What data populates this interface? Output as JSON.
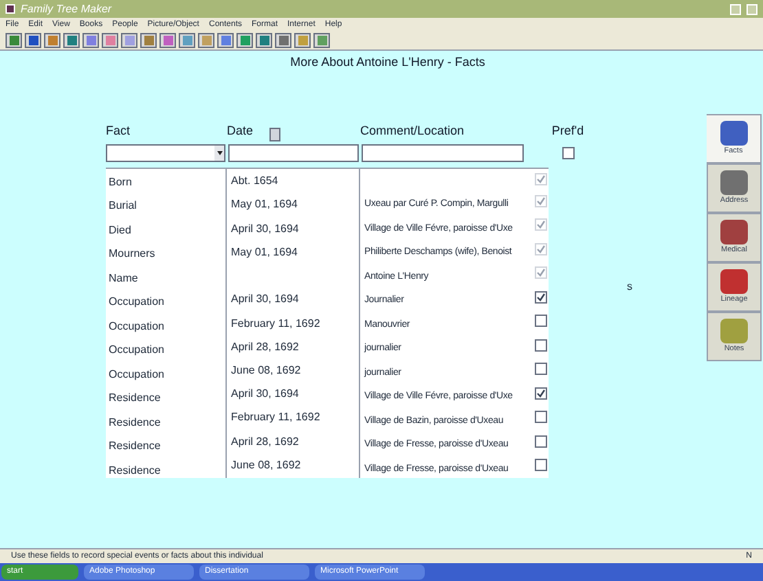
{
  "window": {
    "title": "Family Tree Maker"
  },
  "menu": [
    "File",
    "Edit",
    "View",
    "Books",
    "People",
    "Picture/Object",
    "Contents",
    "Format",
    "Internet",
    "Help"
  ],
  "page_title": "More About Antoine L'Henry - Facts",
  "table": {
    "columns": [
      "Fact",
      "Date",
      "Comment/Location",
      "Pref'd"
    ],
    "new_row": {
      "preferred": false
    },
    "rows": [
      {
        "fact": "Born",
        "date": "Abt. 1654",
        "comment": "",
        "preferred": true,
        "disabled": true
      },
      {
        "fact": "Burial",
        "date": "May 01, 1694",
        "comment": "Uxeau par Curé P. Compin, Margulli",
        "preferred": true,
        "disabled": true
      },
      {
        "fact": "Died",
        "date": "April 30, 1694",
        "comment": "Village de Ville Févre, paroisse d'Uxe",
        "preferred": true,
        "disabled": true
      },
      {
        "fact": "Mourners",
        "date": "May 01, 1694",
        "comment": "Philiberte Deschamps (wife), Benoist",
        "preferred": true,
        "disabled": true
      },
      {
        "fact": "Name",
        "date": "",
        "comment": "Antoine L'Henry",
        "preferred": true,
        "disabled": true
      },
      {
        "fact": "Occupation",
        "date": "April 30, 1694",
        "comment": "Journalier",
        "preferred": true,
        "disabled": false
      },
      {
        "fact": "Occupation",
        "date": "February 11, 1692",
        "comment": "Manouvrier",
        "preferred": false,
        "disabled": false
      },
      {
        "fact": "Occupation",
        "date": "April 28, 1692",
        "comment": "journalier",
        "preferred": false,
        "disabled": false
      },
      {
        "fact": "Occupation",
        "date": "June 08, 1692",
        "comment": "journalier",
        "preferred": false,
        "disabled": false
      },
      {
        "fact": "Residence",
        "date": "April 30, 1694",
        "comment": "Village de Ville Févre, paroisse d'Uxe",
        "preferred": true,
        "disabled": false
      },
      {
        "fact": "Residence",
        "date": "February 11, 1692",
        "comment": "Village de Bazin, paroisse d'Uxeau",
        "preferred": false,
        "disabled": false
      },
      {
        "fact": "Residence",
        "date": "April 28, 1692",
        "comment": "Village de Fresse, paroisse d'Uxeau",
        "preferred": false,
        "disabled": false
      },
      {
        "fact": "Residence",
        "date": "June 08, 1692",
        "comment": "Village de Fresse, paroisse d'Uxeau",
        "preferred": false,
        "disabled": false
      }
    ]
  },
  "stray_text": "s",
  "side_tabs": [
    {
      "label": "Facts",
      "selected": true
    },
    {
      "label": "Address",
      "selected": false
    },
    {
      "label": "Medical",
      "selected": false
    },
    {
      "label": "Lineage",
      "selected": false
    },
    {
      "label": "Notes",
      "selected": false
    }
  ],
  "status_bar": {
    "message": "Use these fields to record special events or facts about this individual",
    "right": "N"
  },
  "taskbar": [
    "start",
    "Adobe Photoshop",
    "Dissertation",
    "Microsoft PowerPoint"
  ]
}
